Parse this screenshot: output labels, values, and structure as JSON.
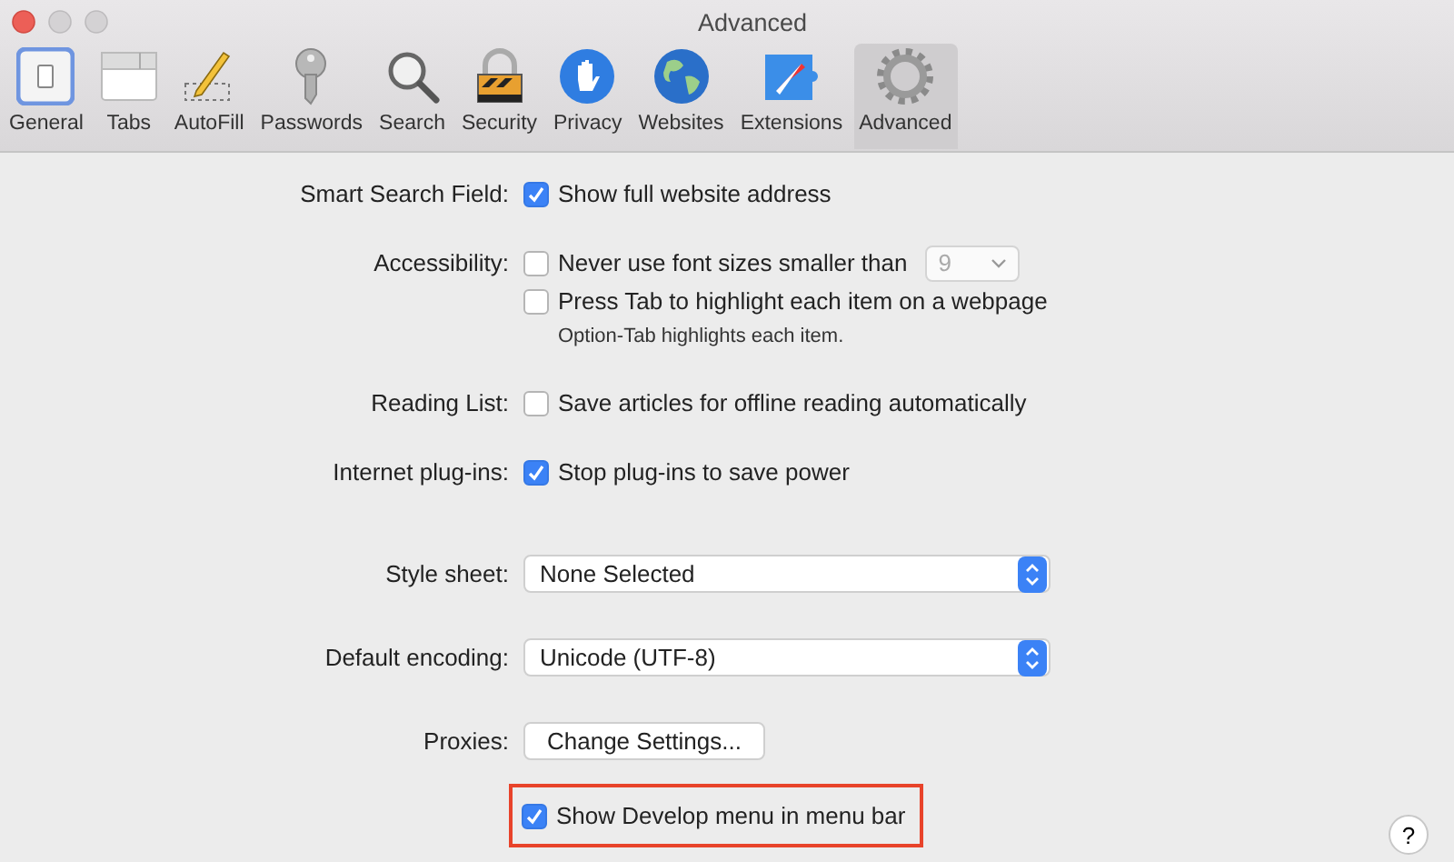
{
  "window": {
    "title": "Advanced"
  },
  "toolbar": [
    {
      "label": "General",
      "kind": "switch",
      "selected": false
    },
    {
      "label": "Tabs",
      "kind": "tabs",
      "selected": false
    },
    {
      "label": "AutoFill",
      "kind": "pencil",
      "selected": false
    },
    {
      "label": "Passwords",
      "kind": "key",
      "selected": false
    },
    {
      "label": "Search",
      "kind": "search",
      "selected": false
    },
    {
      "label": "Security",
      "kind": "lock",
      "selected": false
    },
    {
      "label": "Privacy",
      "kind": "hand",
      "selected": false
    },
    {
      "label": "Websites",
      "kind": "globe",
      "selected": false
    },
    {
      "label": "Extensions",
      "kind": "puzzle",
      "selected": false
    },
    {
      "label": "Advanced",
      "kind": "gear",
      "selected": true
    }
  ],
  "settings": [
    {
      "kind": "checks",
      "label": "Smart Search Field:",
      "checks": [
        {
          "text": "Show full website address",
          "checked": true
        }
      ]
    },
    {
      "kind": "checks",
      "label": "Accessibility:",
      "checks": [
        {
          "text": "Never use font sizes smaller than",
          "checked": false,
          "size": {
            "value": "9",
            "disabled": true
          }
        },
        {
          "text": "Press Tab to highlight each item on a webpage",
          "checked": false
        }
      ],
      "note": "Option-Tab highlights each item."
    },
    {
      "kind": "checks",
      "label": "Reading List:",
      "checks": [
        {
          "text": "Save articles for offline reading automatically",
          "checked": false
        }
      ]
    },
    {
      "kind": "checks",
      "label": "Internet plug-ins:",
      "checks": [
        {
          "text": "Stop plug-ins to save power",
          "checked": true
        }
      ]
    },
    {
      "kind": "select",
      "label": "Style sheet:",
      "value": "None Selected"
    },
    {
      "kind": "select",
      "label": "Default encoding:",
      "value": "Unicode (UTF-8)"
    },
    {
      "kind": "button",
      "label": "Proxies:",
      "button": "Change Settings..."
    },
    {
      "kind": "checks",
      "highlighted": true,
      "checks": [
        {
          "text": "Show Develop menu in menu bar",
          "checked": true
        }
      ]
    }
  ],
  "help_button": "?"
}
